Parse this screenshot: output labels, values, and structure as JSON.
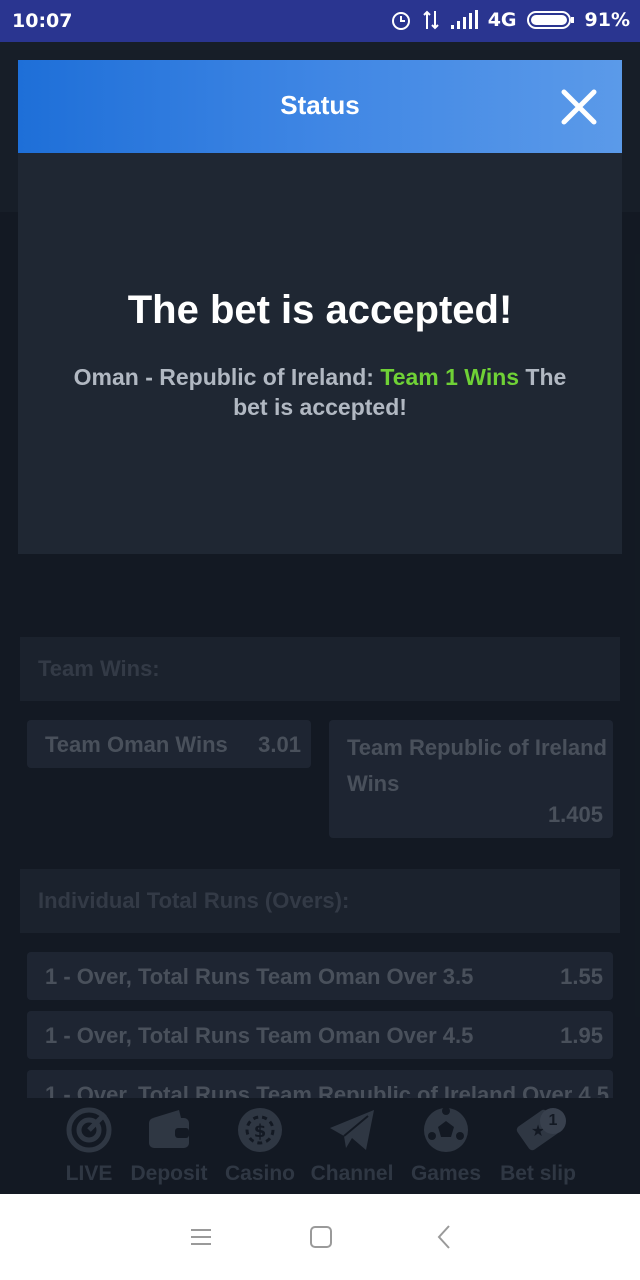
{
  "statusbar": {
    "time": "10:07",
    "network": "4G",
    "battery": "91%"
  },
  "modal": {
    "title": "Status",
    "heading": "The bet is accepted!",
    "msg_prefix": "Oman - Republic of Ireland: ",
    "msg_highlight": "Team 1 Wins",
    "msg_suffix": " The bet is accepted!",
    "highlight_color": "#6fd136"
  },
  "sections": {
    "team_wins": "Team Wins:",
    "individual_total": "Individual Total Runs (Overs):"
  },
  "team_wins_odds": [
    {
      "label": "Team Oman Wins",
      "value": "3.01"
    },
    {
      "label": "Team Republic of Ireland Wins",
      "value": "1.405"
    }
  ],
  "total_runs_odds": [
    {
      "label": "1 - Over, Total Runs Team Oman Over 3.5",
      "value": "1.55"
    },
    {
      "label": "1 - Over, Total Runs Team Oman Over 4.5",
      "value": "1.95"
    },
    {
      "label": "1 - Over, Total Runs Team Republic of Ireland Over 4.5",
      "value": ""
    }
  ],
  "bottom_nav": [
    {
      "label": "LIVE",
      "icon": "live-icon"
    },
    {
      "label": "Deposit",
      "icon": "wallet-icon"
    },
    {
      "label": "Casino",
      "icon": "casino-chip-icon"
    },
    {
      "label": "Channel",
      "icon": "telegram-icon"
    },
    {
      "label": "Games",
      "icon": "soccer-ball-icon"
    },
    {
      "label": "Bet slip",
      "icon": "ticket-icon",
      "badge": "1"
    }
  ]
}
